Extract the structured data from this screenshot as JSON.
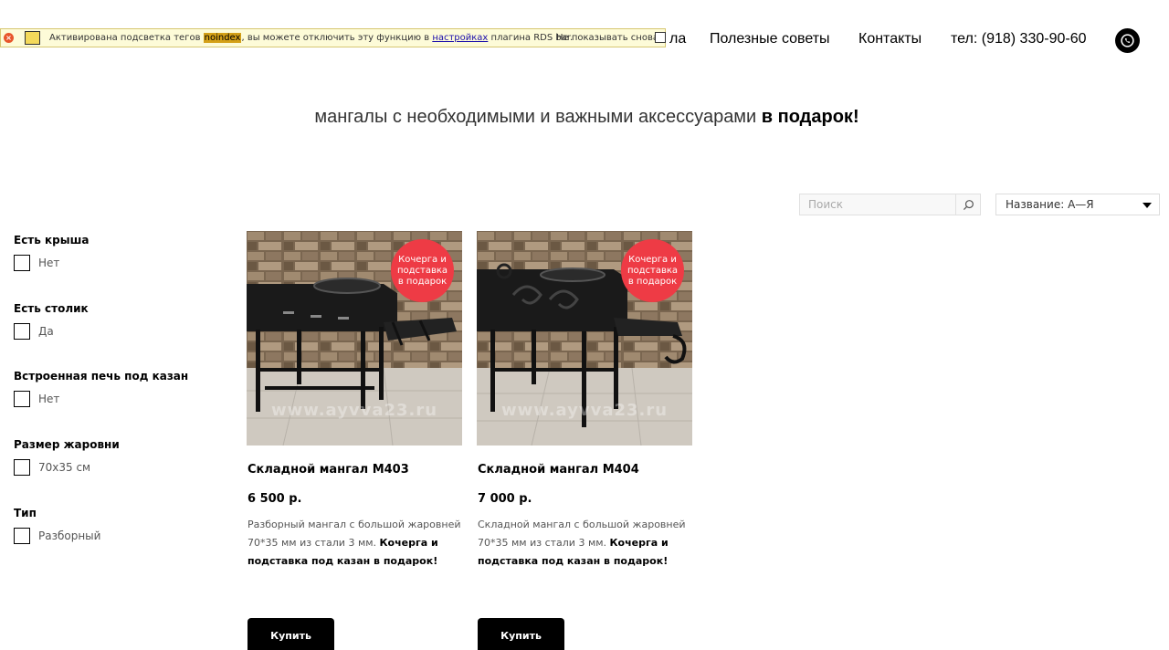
{
  "nav": {
    "partial_label": "ла",
    "tips": "Полезные советы",
    "contacts": "Контакты",
    "phone": "тел: (918) 330-90-60",
    "whatsapp_icon": "whatsapp-icon"
  },
  "rds_bar": {
    "text_before": "Активирована подсветка тегов ",
    "highlight": "noindex",
    "text_middle": ", вы можете отключить эту функцию в ",
    "link": "настройках",
    "text_after": " плагина RDS bar.",
    "hide_label": "Не показывать снова"
  },
  "hero": {
    "text": "мангалы с необходимыми и важными аксессуарами ",
    "bold": "в подарок!"
  },
  "search": {
    "placeholder": "Поиск"
  },
  "sort": {
    "selected": "Название: А—Я"
  },
  "filters": [
    {
      "title": "Есть крыша",
      "option": "Нет"
    },
    {
      "title": "Есть столик",
      "option": "Да"
    },
    {
      "title": "Встроенная печь под казан",
      "option": "Нет"
    },
    {
      "title": "Размер жаровни",
      "option": "70х35 см"
    },
    {
      "title": "Тип",
      "option": "Разборный"
    }
  ],
  "products": [
    {
      "badge": "Кочерга и подставка в подарок",
      "watermark": "www.ayvva23.ru",
      "title": "Складной мангал М403",
      "price": "6 500 р.",
      "desc": "Разборный мангал с большой жаровней  70*35 мм из стали 3 мм. ",
      "desc_bold": "Кочерга и подставка под казан в подарок!",
      "button": "Купить"
    },
    {
      "badge": "Кочерга и подставка в подарок",
      "watermark": "www.ayvva23.ru",
      "title": "Складной мангал М404",
      "price": "7 000 р.",
      "desc": "Складной мангал с большой жаровней 70*35 мм из стали 3 мм. ",
      "desc_bold": "Кочерга и подставка под казан в подарок!",
      "button": "Купить"
    }
  ],
  "colors": {
    "badge": "#ee3b45",
    "button": "#000000",
    "rds_bg": "#fdfbd8"
  }
}
